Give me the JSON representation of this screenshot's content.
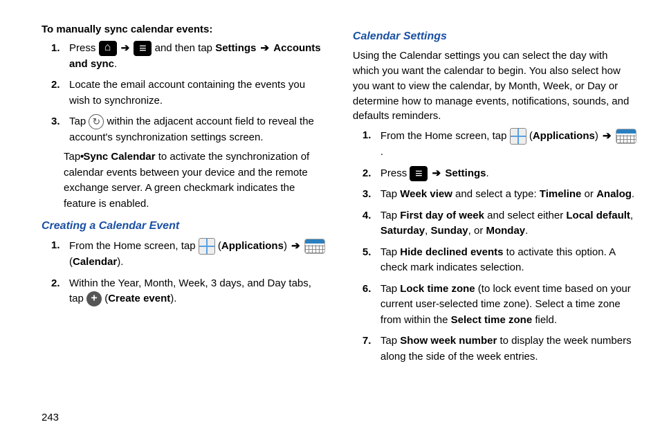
{
  "pageNumber": "243",
  "left": {
    "introTitle": "To manually sync calendar events:",
    "items": [
      {
        "pre": "Press ",
        "mid": " and then tap ",
        "bold1": "Settings",
        "bold2": "Accounts and sync",
        "post": "."
      },
      {
        "text": "Locate the email account containing the events you wish to synchronize."
      },
      {
        "pre": "Tap ",
        "post": " within the adjacent account field to reveal the account's synchronization settings screen."
      }
    ],
    "subBullet": {
      "pre": "Tap ",
      "bold": "Sync Calendar",
      "post": " to activate the synchronization of calendar events between your device and the remote exchange server. A green checkmark indicates the feature is enabled."
    },
    "heading2": "Creating a Calendar Event",
    "items2": [
      {
        "pre": "From the Home screen, tap ",
        "boldApps": "Applications",
        "boldCal": "Calendar"
      },
      {
        "pre": "Within the Year, Month, Week, 3 days, and Day tabs, tap ",
        "bold": "Create event"
      }
    ]
  },
  "right": {
    "heading": "Calendar Settings",
    "intro": "Using the Calendar settings you can select the day with which you want the calendar to begin. You also select how you want to view the calendar, by Month, Week, or Day or determine how to manage events, notifications, sounds, and defaults reminders.",
    "items": [
      {
        "pre": "From the Home screen, tap ",
        "boldApps": "Applications"
      },
      {
        "pre": "Press ",
        "bold": "Settings"
      },
      {
        "pre": "Tap ",
        "bold1": "Week view",
        "mid": " and select a type: ",
        "bold2": "Timeline",
        "or": " or ",
        "bold3": "Analog",
        "post": "."
      },
      {
        "pre": "Tap ",
        "bold1": "First day of week",
        "mid": " and select either ",
        "bold2": "Local default",
        "c1": ", ",
        "bold3": "Saturday",
        "c2": ", ",
        "bold4": "Sunday",
        "or": ", or ",
        "bold5": "Monday",
        "post": "."
      },
      {
        "pre": "Tap ",
        "bold": "Hide declined events",
        "post": " to activate this option. A check mark indicates selection."
      },
      {
        "pre": "Tap ",
        "bold1": "Lock time zone",
        "mid": " (to lock event time based on your current user-selected time zone). Select a time zone from within the ",
        "bold2": "Select time zone",
        "post": " field."
      },
      {
        "pre": "Tap ",
        "bold": "Show week number",
        "post": " to display the week numbers along the side of the week entries."
      }
    ]
  },
  "glyphs": {
    "arrow": "➔"
  }
}
